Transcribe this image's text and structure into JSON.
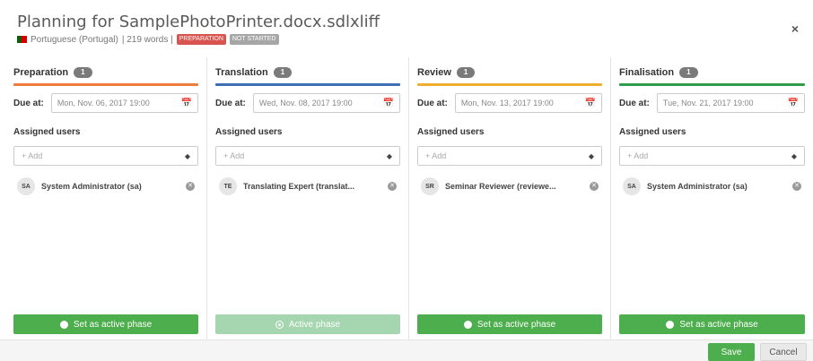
{
  "header": {
    "title": "Planning for SamplePhotoPrinter.docx.sdlxliff",
    "language": "Portuguese (Portugal)",
    "words": "| 219 words |",
    "badge_phase": "PREPARATION",
    "badge_status": "NOT STARTED",
    "close_label": "×"
  },
  "labels": {
    "due_at": "Due at:",
    "assigned_users": "Assigned users",
    "add_placeholder": "+ Add"
  },
  "phases": [
    {
      "name": "Preparation",
      "count": "1",
      "color": "#ee7d3b",
      "due": "Mon, Nov. 06, 2017 19:00",
      "user_initials": "SA",
      "user_name": "System Administrator (sa)",
      "button": "Set as active phase",
      "active": false
    },
    {
      "name": "Translation",
      "count": "1",
      "color": "#3e6fb5",
      "due": "Wed, Nov. 08, 2017 19:00",
      "user_initials": "TE",
      "user_name": "Translating Expert (translat...",
      "button": "Active phase",
      "active": true
    },
    {
      "name": "Review",
      "count": "1",
      "color": "#f0ad2e",
      "due": "Mon, Nov. 13, 2017 19:00",
      "user_initials": "SR",
      "user_name": "Seminar Reviewer (reviewe...",
      "button": "Set as active phase",
      "active": false
    },
    {
      "name": "Finalisation",
      "count": "1",
      "color": "#2e9e4e",
      "due": "Tue, Nov. 21, 2017 19:00",
      "user_initials": "SA",
      "user_name": "System Administrator (sa)",
      "button": "Set as active phase",
      "active": false
    }
  ],
  "footer": {
    "save": "Save",
    "cancel": "Cancel"
  }
}
